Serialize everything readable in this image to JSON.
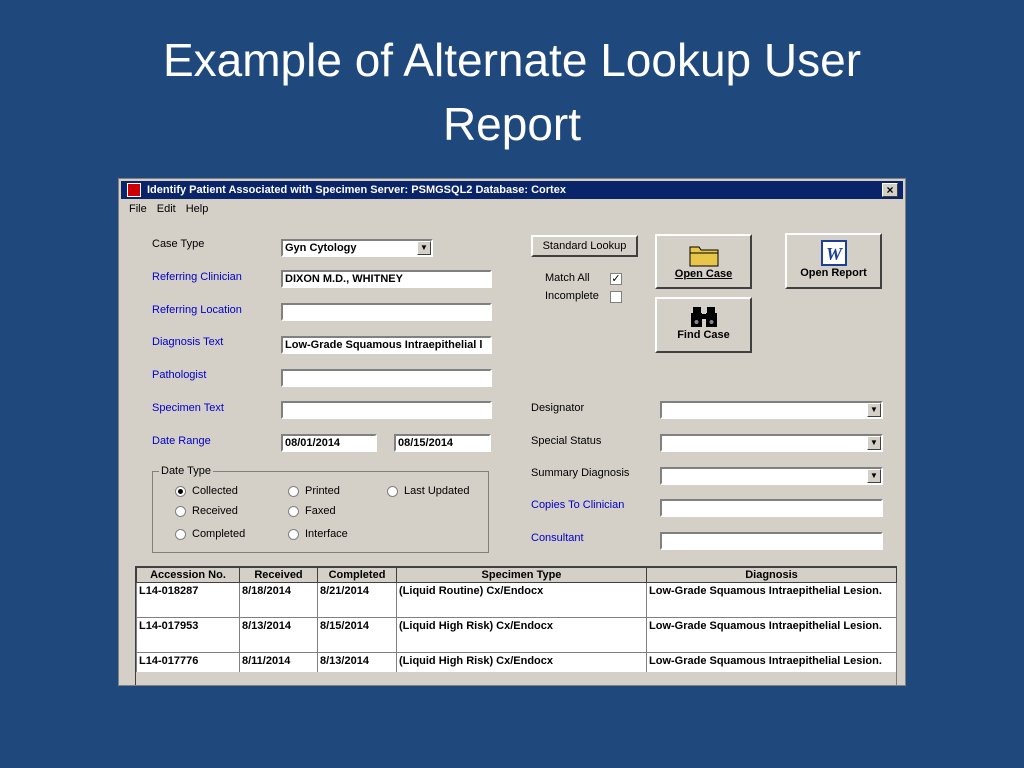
{
  "slide": {
    "title_line1": "Example of Alternate Lookup User",
    "title_line2": "Report"
  },
  "window": {
    "title": "Identify Patient Associated with Specimen    Server: PSMGSQL2    Database: Cortex",
    "close_label": "×"
  },
  "menu": [
    "File",
    "Edit",
    "Help"
  ],
  "form": {
    "case_type_label": "Case Type",
    "case_type_value": "Gyn Cytology",
    "referring_clinician_label": "Referring Clinician",
    "referring_clinician_value": "DIXON M.D., WHITNEY",
    "referring_location_label": "Referring Location",
    "referring_location_value": "",
    "diagnosis_text_label": "Diagnosis Text",
    "diagnosis_text_value": "Low-Grade Squamous Intraepithelial l",
    "pathologist_label": "Pathologist",
    "pathologist_value": "",
    "specimen_text_label": "Specimen Text",
    "specimen_text_value": "",
    "date_range_label": "Date Range",
    "date_from": "08/01/2014",
    "date_to": "08/15/2014",
    "date_type_label": "Date Type",
    "date_type_options": [
      "Collected",
      "Printed",
      "Last Updated",
      "Received",
      "Faxed",
      "Completed",
      "Interface"
    ],
    "date_type_selected": "Collected",
    "match_all_label": "Match All",
    "match_all_checked": true,
    "incomplete_label": "Incomplete",
    "incomplete_checked": false,
    "designator_label": "Designator",
    "special_status_label": "Special Status",
    "summary_diagnosis_label": "Summary Diagnosis",
    "copies_to_clinician_label": "Copies To Clinician",
    "consultant_label": "Consultant"
  },
  "buttons": {
    "standard_lookup": "Standard Lookup",
    "open_case": "Open Case",
    "open_report": "Open Report",
    "find_case": "Find Case"
  },
  "grid": {
    "columns": [
      "Accession No.",
      "Received",
      "Completed",
      "Specimen Type",
      "Diagnosis"
    ],
    "rows": [
      [
        "L14-018287",
        "8/18/2014",
        "8/21/2014",
        "(Liquid Routine)  Cx/Endocx",
        "Low-Grade Squamous Intraepithelial Lesion."
      ],
      [
        "L14-017953",
        "8/13/2014",
        "8/15/2014",
        "(Liquid High Risk)  Cx/Endocx",
        "Low-Grade Squamous Intraepithelial Lesion."
      ],
      [
        "L14-017776",
        "8/11/2014",
        "8/13/2014",
        "(Liquid High Risk)  Cx/Endocx",
        "Low-Grade Squamous Intraepithelial Lesion."
      ]
    ]
  },
  "icons": {
    "open_case": "folder-icon",
    "open_report": "word-document-icon",
    "find_case": "binoculars-icon",
    "app": "app-icon"
  },
  "colors": {
    "slide_background": "#1f497d",
    "titlebar": "#0a246a",
    "link_label": "#0000cc",
    "window_face": "#d4d0c8"
  }
}
